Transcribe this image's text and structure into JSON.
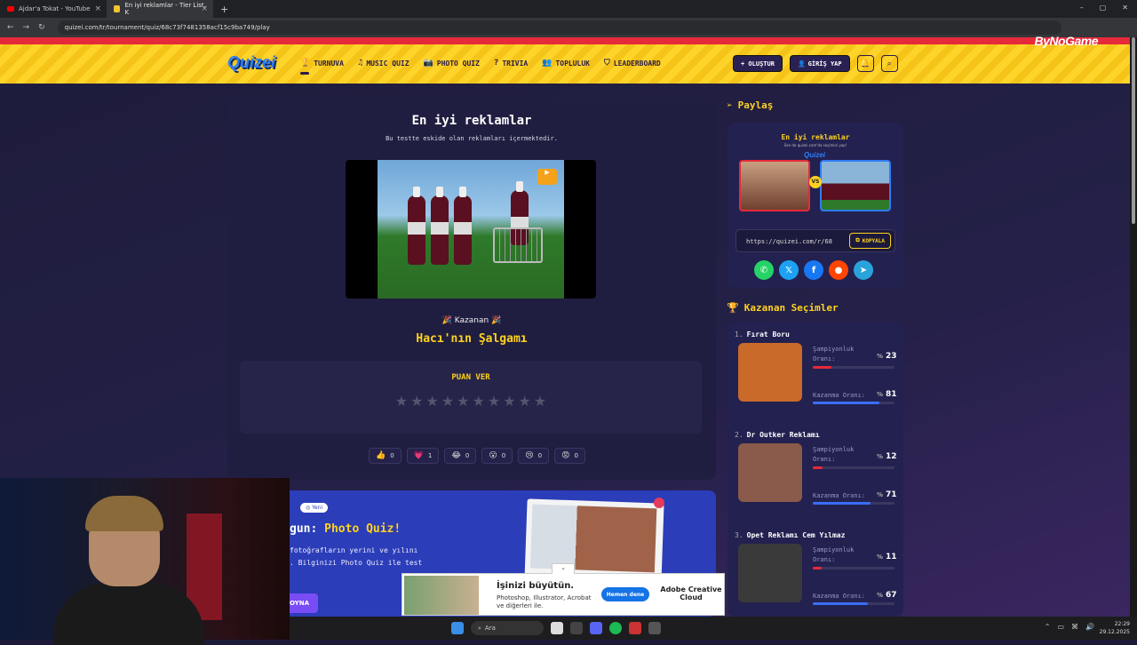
{
  "browser": {
    "tabs": [
      {
        "label": "Ajdar'a Tokat - YouTube",
        "active": false
      },
      {
        "label": "En iyi reklamlar - Tier List, K",
        "active": true
      }
    ],
    "url": "quizei.com/tr/tournament/quiz/68c73f7481358acf15c9ba749/play",
    "window_controls": [
      "–",
      "▢",
      "✕"
    ]
  },
  "watermark": "ByNoGame",
  "header": {
    "logo": "Quizei",
    "menu": [
      {
        "label": "TURNUVA",
        "icon": "trophy-icon",
        "glyph": "🏆",
        "active": true
      },
      {
        "label": "MUSIC QUIZ",
        "icon": "music-icon",
        "glyph": "♫",
        "active": false
      },
      {
        "label": "PHOTO QUIZ",
        "icon": "camera-icon",
        "glyph": "📷",
        "active": false
      },
      {
        "label": "TRIVIA",
        "icon": "question-icon",
        "glyph": "?",
        "active": false
      },
      {
        "label": "TOPLULUK",
        "icon": "users-icon",
        "glyph": "👥",
        "active": false
      },
      {
        "label": "LEADERBOARD",
        "icon": "shield-icon",
        "glyph": "⛉",
        "active": false
      }
    ],
    "create_label": "+ OLUŞTUR",
    "login_label": "GİRİŞ YAP"
  },
  "quiz": {
    "title": "En iyi reklamlar",
    "subtitle": "Bu testte eskide olan reklamları içermektedir.",
    "winner_label": "Kazanan",
    "winner_name": "Hacı'nın Şalgamı",
    "rating_title": "PUAN VER",
    "stars_total": 10,
    "stars_filled": 0,
    "reactions": [
      {
        "emoji": "👍",
        "count": "0"
      },
      {
        "emoji": "💗",
        "count": "1"
      },
      {
        "emoji": "😂",
        "count": "0"
      },
      {
        "emoji": "😮",
        "count": "0"
      },
      {
        "emoji": "😢",
        "count": "0"
      },
      {
        "emoji": "😡",
        "count": "0"
      }
    ]
  },
  "promo": {
    "badge": "Yeni",
    "heading_prefix": "gun: ",
    "heading_highlight": "Photo Quiz!",
    "line1": "fotoğrafların yerini ve yılını",
    "line2": ". Bilginizi Photo Quiz ile test",
    "play_label": "OYNA"
  },
  "share": {
    "heading": "Paylaş",
    "card_title": "En iyi reklamlar",
    "card_sub": "Sen de quizei.com'da seçimini yap!",
    "card_logo": "Quizei",
    "link": "https://quizei.com/r/68",
    "copy_label": "KOPYALA",
    "socials": [
      {
        "name": "whatsapp-icon",
        "glyph": "✆",
        "color": "#25d366"
      },
      {
        "name": "x-icon",
        "glyph": "𝕏",
        "color": "#1da1f2"
      },
      {
        "name": "facebook-icon",
        "glyph": "f",
        "color": "#1877f2"
      },
      {
        "name": "reddit-icon",
        "glyph": "●",
        "color": "#ff4500"
      },
      {
        "name": "telegram-icon",
        "glyph": "➤",
        "color": "#2aa3dd"
      }
    ]
  },
  "winners": {
    "heading": "Kazanan Seçimler",
    "champ_label": "Şampiyonluk Oranı:",
    "win_label": "Kazanma Oranı:",
    "items": [
      {
        "rank": "1.",
        "name": "Fırat Boru",
        "champ": "23",
        "win": "81",
        "champ_frac": 0.23,
        "win_frac": 0.81,
        "img_color": "#c96a2a"
      },
      {
        "rank": "2.",
        "name": "Dr Outker Reklamı",
        "champ": "12",
        "win": "71",
        "champ_frac": 0.12,
        "win_frac": 0.71,
        "img_color": "#8a5a4a"
      },
      {
        "rank": "3.",
        "name": "Opet Reklamı Cem Yılmaz",
        "champ": "11",
        "win": "67",
        "champ_frac": 0.11,
        "win_frac": 0.67,
        "img_color": "#3a3a3a"
      }
    ]
  },
  "ad": {
    "title": "İşinizi büyütün.",
    "body": "Photoshop, Illustrator, Acrobat ve diğerleri ile.",
    "cta": "Hemen dene",
    "brand": "Adobe Creative Cloud"
  },
  "taskbar": {
    "search": "Ara",
    "time": "22:29",
    "date": "29.12.2025"
  }
}
